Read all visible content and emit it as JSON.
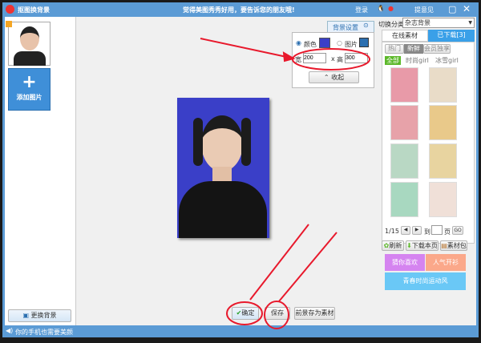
{
  "title": "抠图换背景",
  "slogan": "觉得美图秀秀好用，要告诉您的朋友哦!",
  "login": "登录",
  "feedback": "提意见",
  "left": {
    "add_image": "添加图片",
    "change_bg": "更换背景"
  },
  "bg_settings": {
    "tab": "背景设置",
    "color_label": "颜色",
    "image_label": "图片",
    "width_label": "宽",
    "width": "200",
    "x": "x",
    "height_label": "高",
    "height": "300",
    "collapse": "收起",
    "color": "#3a3fc8"
  },
  "right": {
    "category_label": "切换分类",
    "category": "杂志背景",
    "tabs": [
      "在线素材",
      "已下载[3]"
    ],
    "subtabs": [
      "热门",
      "新鲜",
      "会员独享"
    ],
    "filters": [
      "全部",
      "时尚girl",
      "冰雪girl"
    ],
    "page": "1/15",
    "goto": "到",
    "page_unit": "页",
    "go": "GO",
    "refresh": "刷新",
    "download_page": "下载本页",
    "pack": "素材包",
    "promo": [
      "猜你喜欢",
      "人气开衫",
      "青春时尚运动风"
    ]
  },
  "actions": {
    "confirm": "确定",
    "save": "保存",
    "save_fg": "前景存为素材"
  },
  "status": "你的手机也需要美颜",
  "colors": {
    "titlebar": "#5b9bd5",
    "accent": "#3aa0e8",
    "annotation": "#e8192c"
  }
}
